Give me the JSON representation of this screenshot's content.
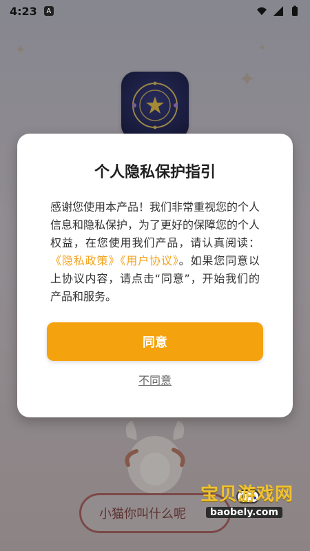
{
  "status_bar": {
    "time": "4:23",
    "notification_icon": "A"
  },
  "background": {
    "bubble_text": "小猫你叫什么呢",
    "watermark_title": "宝贝游戏网",
    "watermark_url": "baobely.com"
  },
  "dialog": {
    "title": "个人隐私保护指引",
    "body_before": "感谢您使用本产品！我们非常重视您的个人信息和隐私保护，为了更好的保障您的个人权益，在您使用我们产品，请认真阅读：",
    "privacy_link": "《隐私政策》",
    "user_agreement_link": "《用户协议》",
    "body_after": "。如果您同意以上协议内容，请点击“同意”，开始我们的产品和服务。",
    "agree_label": "同意",
    "disagree_label": "不同意"
  },
  "colors": {
    "accent": "#F5A20F",
    "link": "#F3A21B"
  }
}
